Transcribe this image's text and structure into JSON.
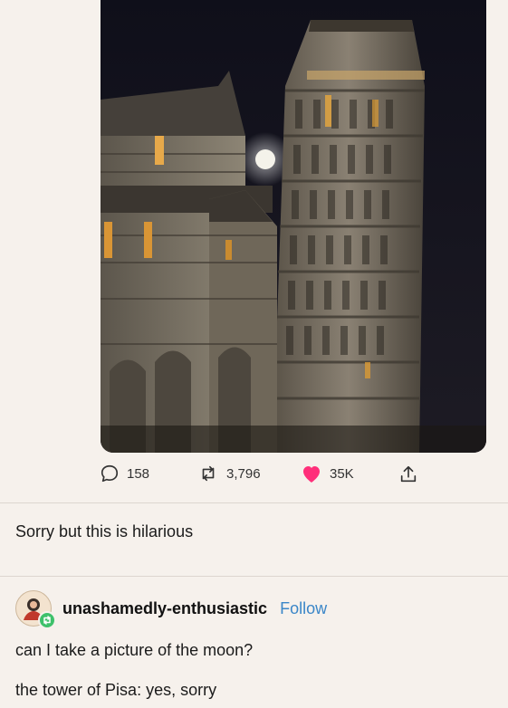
{
  "post": {
    "stats": {
      "comments": "158",
      "reblogs": "3,796",
      "likes": "35K"
    },
    "caption": "Sorry but this is hilarious"
  },
  "reblog": {
    "username": "unashamedly-enthusiastic",
    "follow_label": "Follow",
    "lines": [
      "can I take a picture of the moon?",
      "the tower of Pisa: yes, sorry"
    ]
  },
  "colors": {
    "background": "#f6f1ec",
    "like_heart": "#ff2f7a",
    "follow_link": "#3a86c8",
    "reblog_badge": "#3ec16b"
  },
  "icons": {
    "comments": "speech-bubble-icon",
    "reblogs": "reblog-arrows-icon",
    "likes": "heart-icon",
    "share": "share-icon"
  }
}
